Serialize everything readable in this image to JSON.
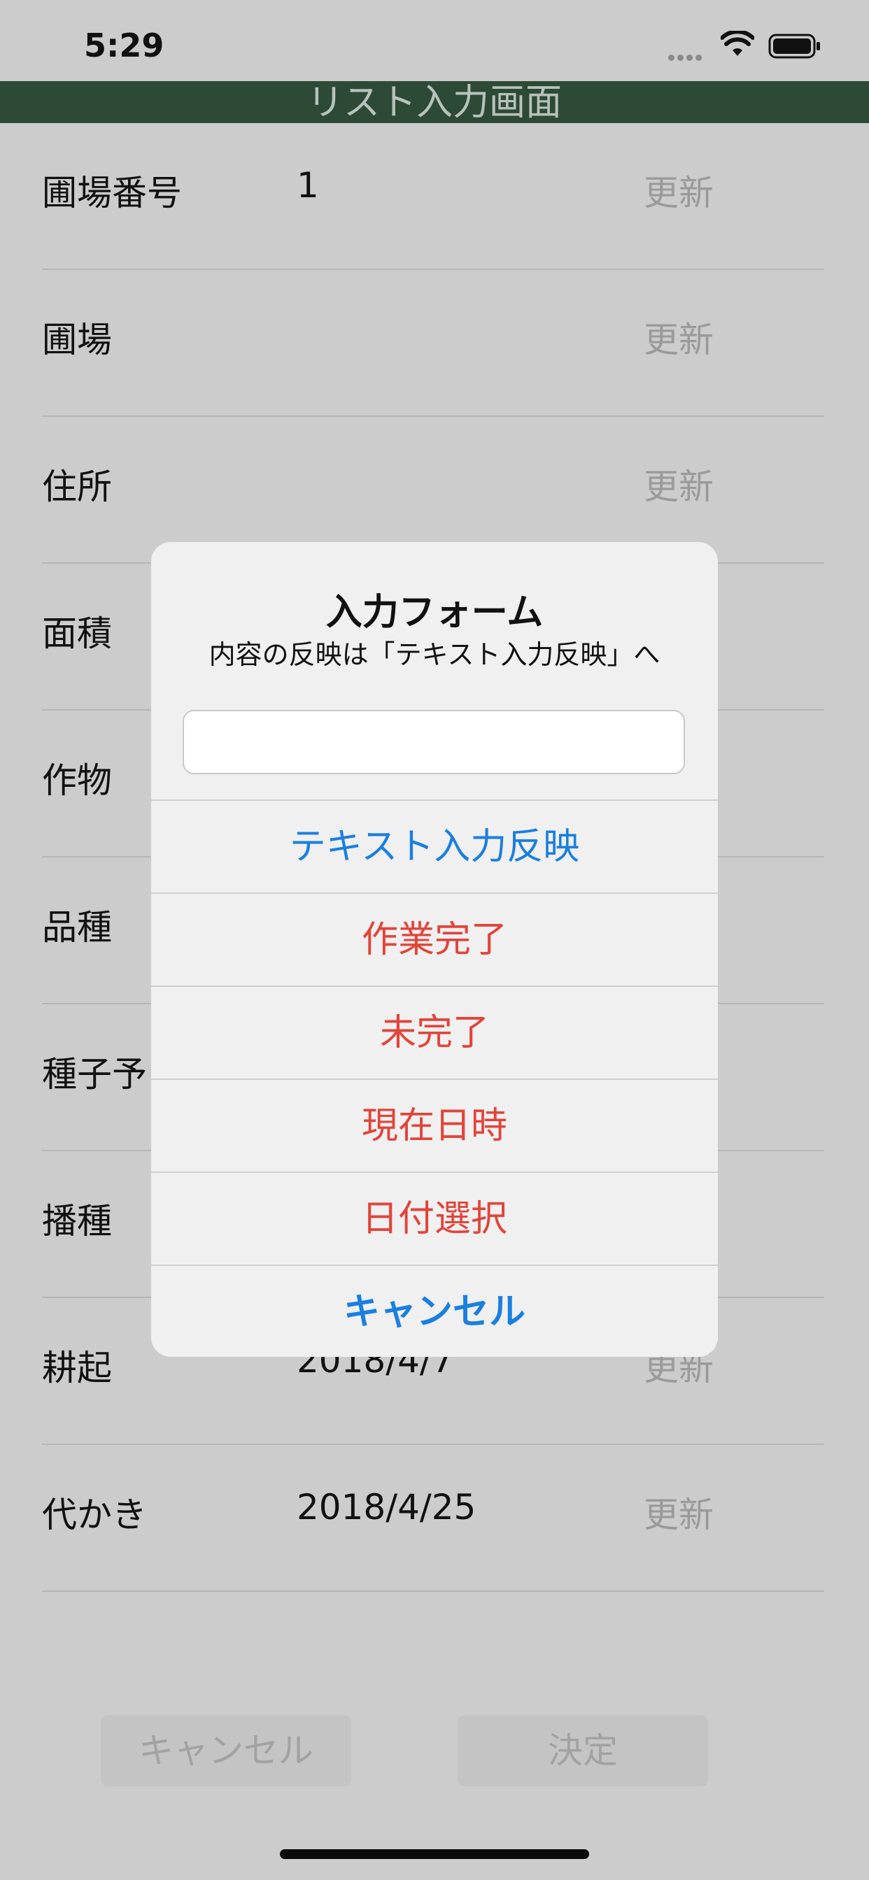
{
  "status": {
    "time": "5:29"
  },
  "nav": {
    "title": "リスト入力画面"
  },
  "rows": [
    {
      "label": "圃場番号",
      "value": "1",
      "update": "更新"
    },
    {
      "label": "圃場",
      "value": "",
      "update": "更新"
    },
    {
      "label": "住所",
      "value": "",
      "update": "更新"
    },
    {
      "label": "面積",
      "value": "",
      "update": ""
    },
    {
      "label": "作物",
      "value": "",
      "update": ""
    },
    {
      "label": "品種",
      "value": "",
      "update": ""
    },
    {
      "label": "種子予",
      "value": "",
      "update": ""
    },
    {
      "label": "播種",
      "value": "",
      "update": ""
    },
    {
      "label": "耕起",
      "value": "2018/4/7",
      "update": "更新"
    },
    {
      "label": "代かき",
      "value": "2018/4/25",
      "update": "更新"
    }
  ],
  "bottom": {
    "cancel": "キャンセル",
    "confirm": "決定"
  },
  "dialog": {
    "title": "入力フォーム",
    "message": "内容の反映は「テキスト入力反映」へ",
    "input_value": "",
    "actions": [
      {
        "label": "テキスト入力反映",
        "color": "#1a7fe0"
      },
      {
        "label": "作業完了",
        "color": "#e2443a"
      },
      {
        "label": "未完了",
        "color": "#e2443a"
      },
      {
        "label": "現在日時",
        "color": "#e2443a"
      },
      {
        "label": "日付選択",
        "color": "#e2443a"
      },
      {
        "label": "キャンセル",
        "color": "#1a7fe0"
      }
    ]
  }
}
